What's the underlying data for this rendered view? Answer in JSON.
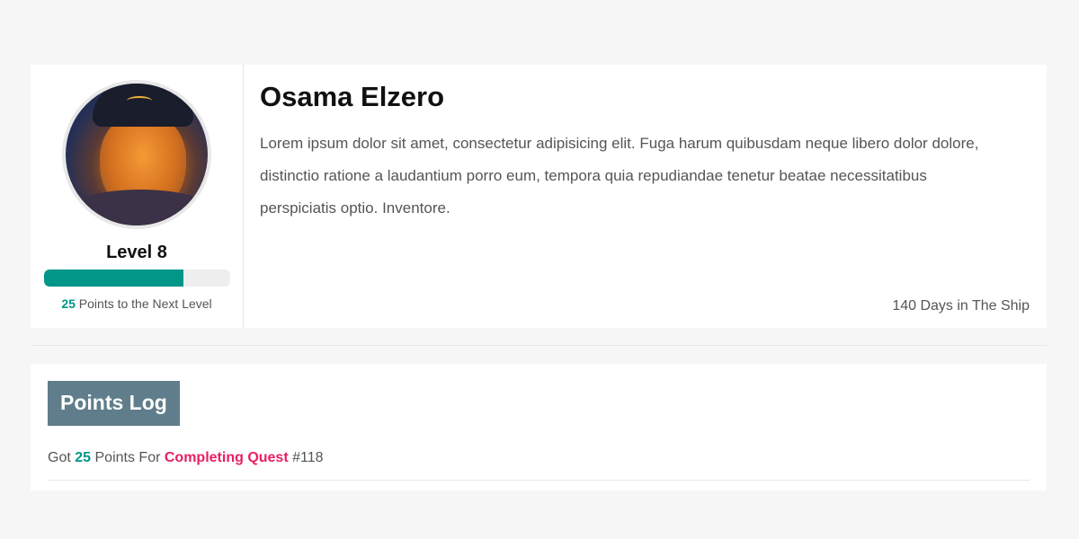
{
  "profile": {
    "name": "Osama Elzero",
    "bio": "Lorem ipsum dolor sit amet, consectetur adipisicing elit. Fuga harum quibusdam neque libero dolor dolore, distinctio ratione a laudantium porro eum, tempora quia repudiandae tenetur beatae necessitatibus perspiciatis optio. Inventore.",
    "level_label": "Level 8",
    "progress_percent": 75,
    "points_to_next": "25",
    "points_to_next_text": "Points to the Next Level",
    "days_text": "140 Days in The Ship"
  },
  "points_log": {
    "title": "Points Log",
    "items": [
      {
        "prefix": "Got",
        "points": "25",
        "middle": "Points For",
        "action": "Completing Quest",
        "quest_id": "#118"
      }
    ]
  },
  "colors": {
    "accent": "#009688",
    "highlight": "#e91e63",
    "header_badge": "#607d8b",
    "background": "#f6f6f6"
  }
}
